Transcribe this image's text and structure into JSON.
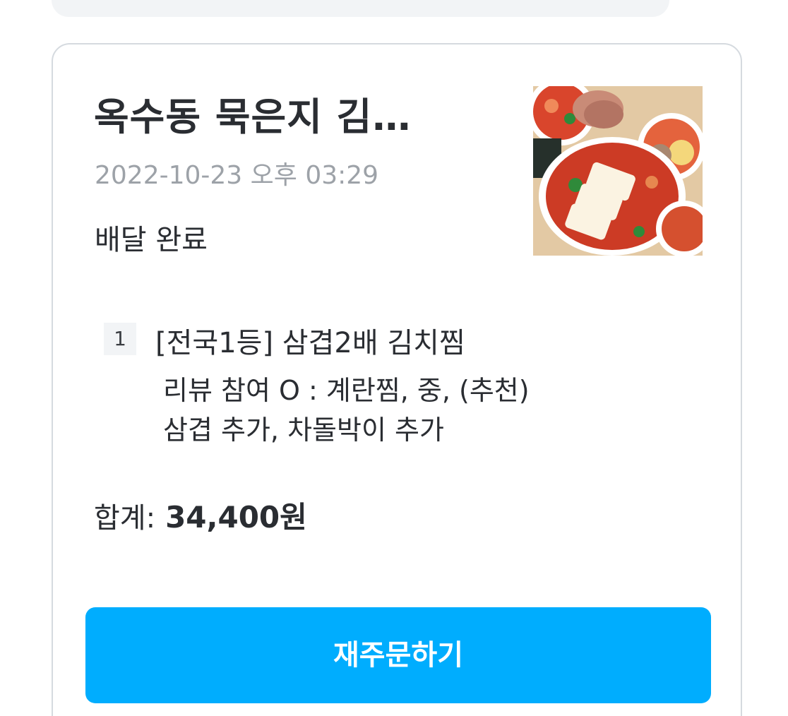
{
  "order": {
    "store_name": "옥수동 묵은지 김…",
    "datetime": "2022-10-23 오후 03:29",
    "status": "배달 완료",
    "item": {
      "quantity": "1",
      "name": "[전국1등] 삼겹2배 김치찜",
      "options_line1": "리뷰 참여 O : 계란찜, 중, (추천)",
      "options_line2": "삼겹 추가, 차돌박이 추가"
    },
    "total_label": "합계:",
    "total_amount": "34,400원",
    "reorder_label": "재주문하기"
  },
  "colors": {
    "accent": "#00adfe",
    "text_primary": "#2a2d32",
    "text_secondary": "#9da2a8",
    "card_border": "#d5dadf",
    "badge_bg": "#f2f4f6"
  }
}
